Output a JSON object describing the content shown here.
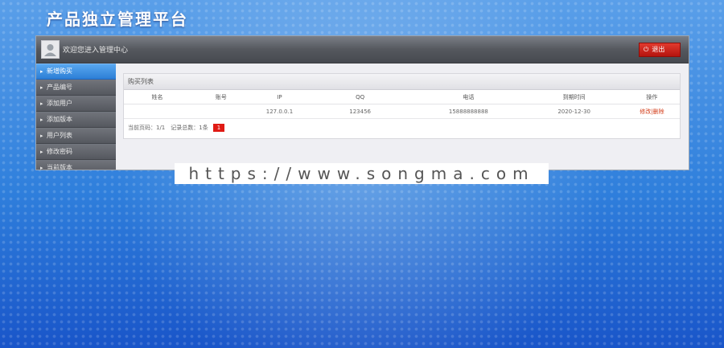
{
  "site_title": "产品独立管理平台",
  "topbar": {
    "welcome_text": "欢迎您进入管理中心",
    "logout_label": "退出",
    "logout_icon": "power-icon",
    "avatar_icon": "user-avatar-icon"
  },
  "sidebar": {
    "items": [
      {
        "label": "新增购买"
      },
      {
        "label": "产品编号"
      },
      {
        "label": "添加用户"
      },
      {
        "label": "添加版本"
      },
      {
        "label": "用户列表"
      },
      {
        "label": "修改密码"
      },
      {
        "label": "当前版本"
      }
    ]
  },
  "content": {
    "title": "购买列表",
    "columns": [
      "姓名",
      "账号",
      "IP",
      "QQ",
      "电话",
      "到期时间",
      "操作"
    ],
    "rows": [
      {
        "name": "",
        "account": "",
        "ip": "127.0.0.1",
        "qq": "123456",
        "phone": "15888888888",
        "expire": "2020-12-30",
        "action": "修改|删除"
      }
    ],
    "pager": {
      "text": "当前页码：1/1　记录总数：1条",
      "page": "1"
    }
  },
  "watermark": "https://www.songma.com",
  "colors": {
    "accent_blue": "#2d7fd6",
    "logout_red": "#c91b13",
    "page_btn_red": "#e01b15",
    "background_blue": "#2f7fdc"
  }
}
